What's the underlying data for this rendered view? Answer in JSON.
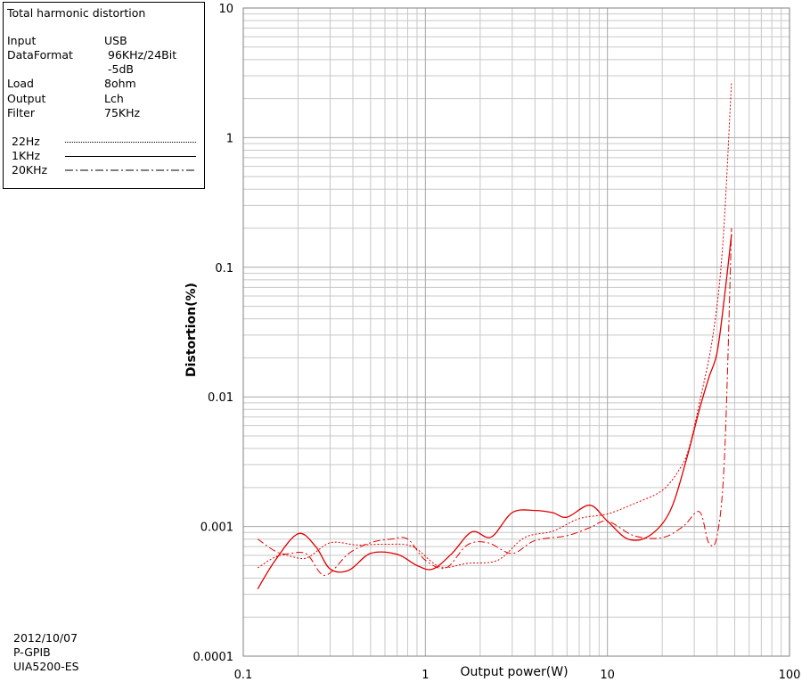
{
  "legend_box": {
    "title": "Total harmonic distortion",
    "params": [
      {
        "key": "Input",
        "value": "USB"
      },
      {
        "key": "DataFormat",
        "value": "96KHz/24Bit"
      },
      {
        "key": "",
        "value": "-5dB"
      },
      {
        "key": "Load",
        "value": "8ohm"
      },
      {
        "key": "Output",
        "value": "Lch"
      },
      {
        "key": "Filter",
        "value": "75KHz"
      }
    ],
    "series_labels": [
      "22Hz",
      "1KHz",
      "20KHz"
    ]
  },
  "footer": {
    "date": "2012/10/07",
    "interface": "P-GPIB",
    "instrument": "UIA5200-ES"
  },
  "colors": {
    "curve": "#e00000",
    "grid": "#c8c8c8",
    "frame": "#000000"
  },
  "chart_data": {
    "type": "line",
    "xlabel": "Output power(W)",
    "ylabel": "Distortion(%)",
    "xscale": "log",
    "yscale": "log",
    "xlim": [
      0.1,
      100
    ],
    "ylim": [
      0.0001,
      10
    ],
    "xticks": [
      "0.1",
      "1",
      "10",
      "100"
    ],
    "yticks": [
      "0.0001",
      "0.001",
      "0.01",
      "0.1",
      "1",
      "10"
    ],
    "grid": true,
    "series": [
      {
        "name": "22Hz",
        "style": "dotted",
        "x": [
          0.12,
          0.16,
          0.22,
          0.3,
          0.42,
          0.6,
          0.85,
          1.2,
          1.7,
          2.5,
          3.5,
          5,
          7,
          10,
          14,
          20,
          25,
          28,
          32,
          38,
          43,
          48
        ],
        "y": [
          0.00048,
          0.0006,
          0.00057,
          0.00075,
          0.00072,
          0.00073,
          0.0007,
          0.00049,
          0.00052,
          0.00055,
          0.00082,
          0.00092,
          0.00115,
          0.00125,
          0.0015,
          0.0019,
          0.0028,
          0.004,
          0.009,
          0.03,
          0.15,
          2.7
        ]
      },
      {
        "name": "1KHz",
        "style": "solid",
        "x": [
          0.12,
          0.15,
          0.2,
          0.25,
          0.3,
          0.38,
          0.5,
          0.7,
          0.9,
          1.1,
          1.4,
          1.8,
          2.3,
          3,
          4,
          5,
          6,
          8,
          10,
          13,
          17,
          22,
          27,
          32,
          36,
          40,
          44,
          48
        ],
        "y": [
          0.00033,
          0.00055,
          0.00088,
          0.0007,
          0.00047,
          0.00046,
          0.00062,
          0.00061,
          0.0005,
          0.00047,
          0.00062,
          0.00091,
          0.00083,
          0.00128,
          0.00133,
          0.00128,
          0.00118,
          0.00146,
          0.0011,
          0.0008,
          0.00085,
          0.0013,
          0.0032,
          0.008,
          0.014,
          0.022,
          0.06,
          0.18
        ]
      },
      {
        "name": "20KHz",
        "style": "dashdot",
        "x": [
          0.12,
          0.16,
          0.22,
          0.28,
          0.38,
          0.5,
          0.65,
          0.8,
          1.0,
          1.3,
          1.7,
          2.2,
          3,
          4,
          6,
          8,
          10,
          14,
          20,
          26,
          32,
          36,
          40,
          44,
          48
        ],
        "y": [
          0.0008,
          0.00062,
          0.00062,
          0.00042,
          0.00062,
          0.00075,
          0.0008,
          0.0008,
          0.00055,
          0.00048,
          0.00072,
          0.00075,
          0.00062,
          0.00078,
          0.00085,
          0.00098,
          0.0011,
          0.00085,
          0.00082,
          0.001,
          0.0013,
          0.00075,
          0.00085,
          0.0035,
          0.2
        ]
      }
    ]
  }
}
